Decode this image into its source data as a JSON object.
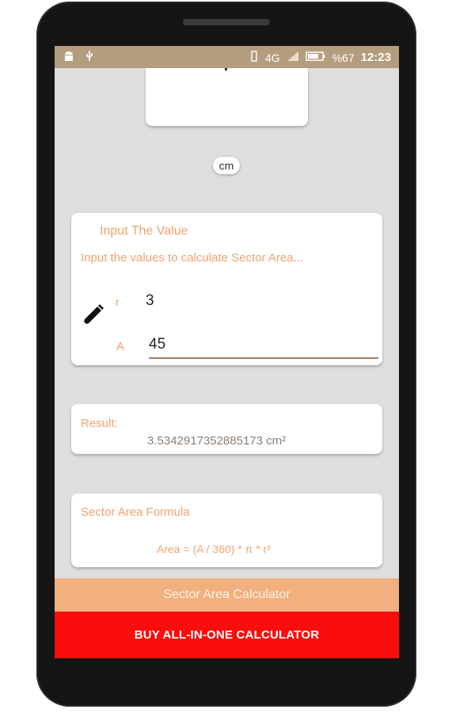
{
  "status_bar": {
    "network": "4G",
    "battery": "%67",
    "time": "12:23"
  },
  "unit": "cm",
  "input_card": {
    "title": "Input The Value",
    "subtitle": "Input the values to calculate Sector Area...",
    "r_label": "r",
    "r_value": "3",
    "a_label": "A",
    "a_value": "45"
  },
  "result_card": {
    "label": "Result:",
    "value": "3.5342917352885173 cm²"
  },
  "formula_card": {
    "label": "Sector Area Formula",
    "formula": "Area = (A / 360) *  π * r²"
  },
  "bottom": {
    "title": "Sector Area Calculator",
    "buy_button": "BUY ALL-IN-ONE CALCULATOR"
  },
  "colors": {
    "accent": "#f0a36d",
    "status_bar": "#b49d7e",
    "buy": "#fb0d0d",
    "title_bar": "#f2b07f"
  }
}
